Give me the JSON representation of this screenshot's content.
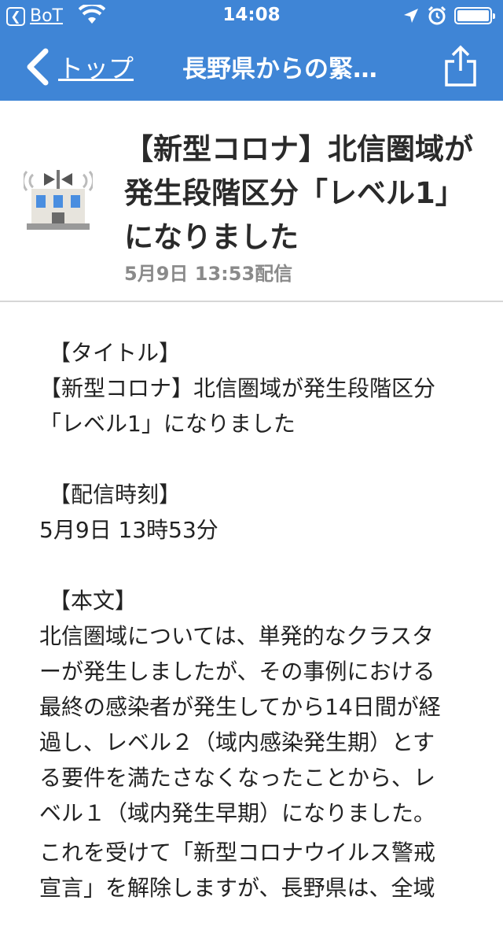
{
  "status_bar": {
    "back_app_label": "BoT",
    "time": "14:08"
  },
  "nav": {
    "back_label": "トップ",
    "title": "長野県からの緊…"
  },
  "article": {
    "title": "【新型コロナ】北信圏域が発生段階区分「レベル1」になりました",
    "published": "5月9日 13:53配信"
  },
  "body": {
    "title_label": "【タイトル】",
    "title_text_1": "【新型コロナ】北信圏域が発生段階区分",
    "title_text_2": "「レベル1」になりました",
    "time_label": "【配信時刻】",
    "time_text": "5月9日 13時53分",
    "body_label": "【本文】",
    "body_lines": [
      "北信圏域については、単発的なクラスタ",
      "ーが発生しましたが、その事例における",
      "最終の感染者が発生してから14日間が経",
      "過し、レベル２（域内感染発生期）とす",
      "る要件を満たさなくなったことから、レ",
      "ベル１（域内発生早期）になりました。",
      "これを受けて「新型コロナウイルス警戒",
      "宣言」を解除しますが、長野県は、全域"
    ]
  }
}
